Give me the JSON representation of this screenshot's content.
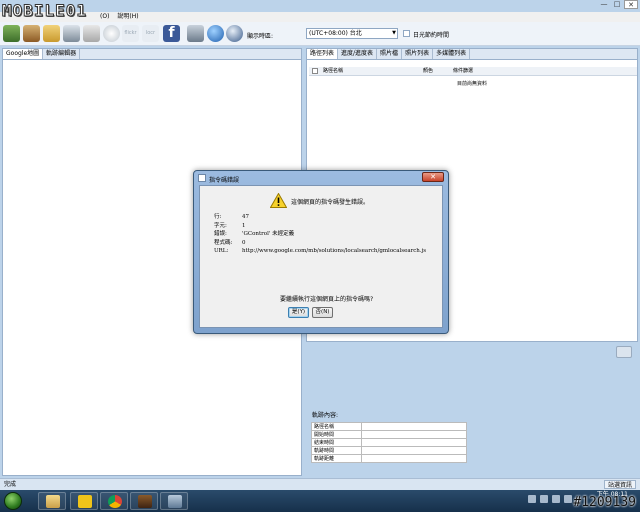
{
  "watermark": {
    "brand": "MOBILE01",
    "image_id": "#1209139"
  },
  "window": {
    "controls": [
      "—",
      "□",
      "✕"
    ]
  },
  "menubar": {
    "items": [
      "(O)",
      "說明(H)"
    ]
  },
  "toolbar": {
    "timezone_label": "顯示時區:",
    "timezone_value": "(UTC+08:00) 台北",
    "dst_label": "日光節約時間",
    "icons": [
      "gps-device-icon",
      "download-icon",
      "open-folder-icon",
      "save-icon",
      "photo-icon",
      "clock-icon",
      "flickr-icon",
      "locr-icon",
      "facebook-icon",
      "google-earth-icon",
      "globe-icon",
      "sync-icon"
    ]
  },
  "left_panel": {
    "tabs": [
      "Google地圖",
      "軌跡編輯器"
    ]
  },
  "right_panel": {
    "tabs": [
      "路徑列表",
      "進度/進度表",
      "照片檔",
      "照片列表",
      "多媒體列表"
    ],
    "columns": [
      "路徑名稱",
      "顏色",
      "條件篩選"
    ],
    "empty_text": "目前尚無資料"
  },
  "details": {
    "label": "軌跡內容:",
    "rows": [
      "路徑名稱",
      "開始時間",
      "結束時間",
      "軌跡時間",
      "軌跡距離"
    ]
  },
  "statusbar": {
    "left_text": "完成",
    "right_button": "站選資訊"
  },
  "taskbar": {
    "clock_time": "下午 08:11",
    "clock_date": ""
  },
  "dialog": {
    "title": "指令碼錯誤",
    "heading": "這個網頁的指令碼發生錯誤。",
    "fields": [
      {
        "key": "行:",
        "value": "47"
      },
      {
        "key": "字元:",
        "value": "1"
      },
      {
        "key": "錯誤:",
        "value": "'GControl' 未經定義"
      },
      {
        "key": "程式碼:",
        "value": "0"
      },
      {
        "key": "URL:",
        "value": "http://www.google.com/mb/solutions/localsearch/gmlocalsearch.js"
      }
    ],
    "question": "要繼續執行這個網頁上的指令碼嗎?",
    "yes_button": "是(Y)",
    "no_button": "否(N)"
  },
  "colors": {
    "accent": "#bcd3ea",
    "dialog_frame": "#8fb0d8",
    "close_red": "#c8432a",
    "taskbar": "#1f3b58"
  }
}
